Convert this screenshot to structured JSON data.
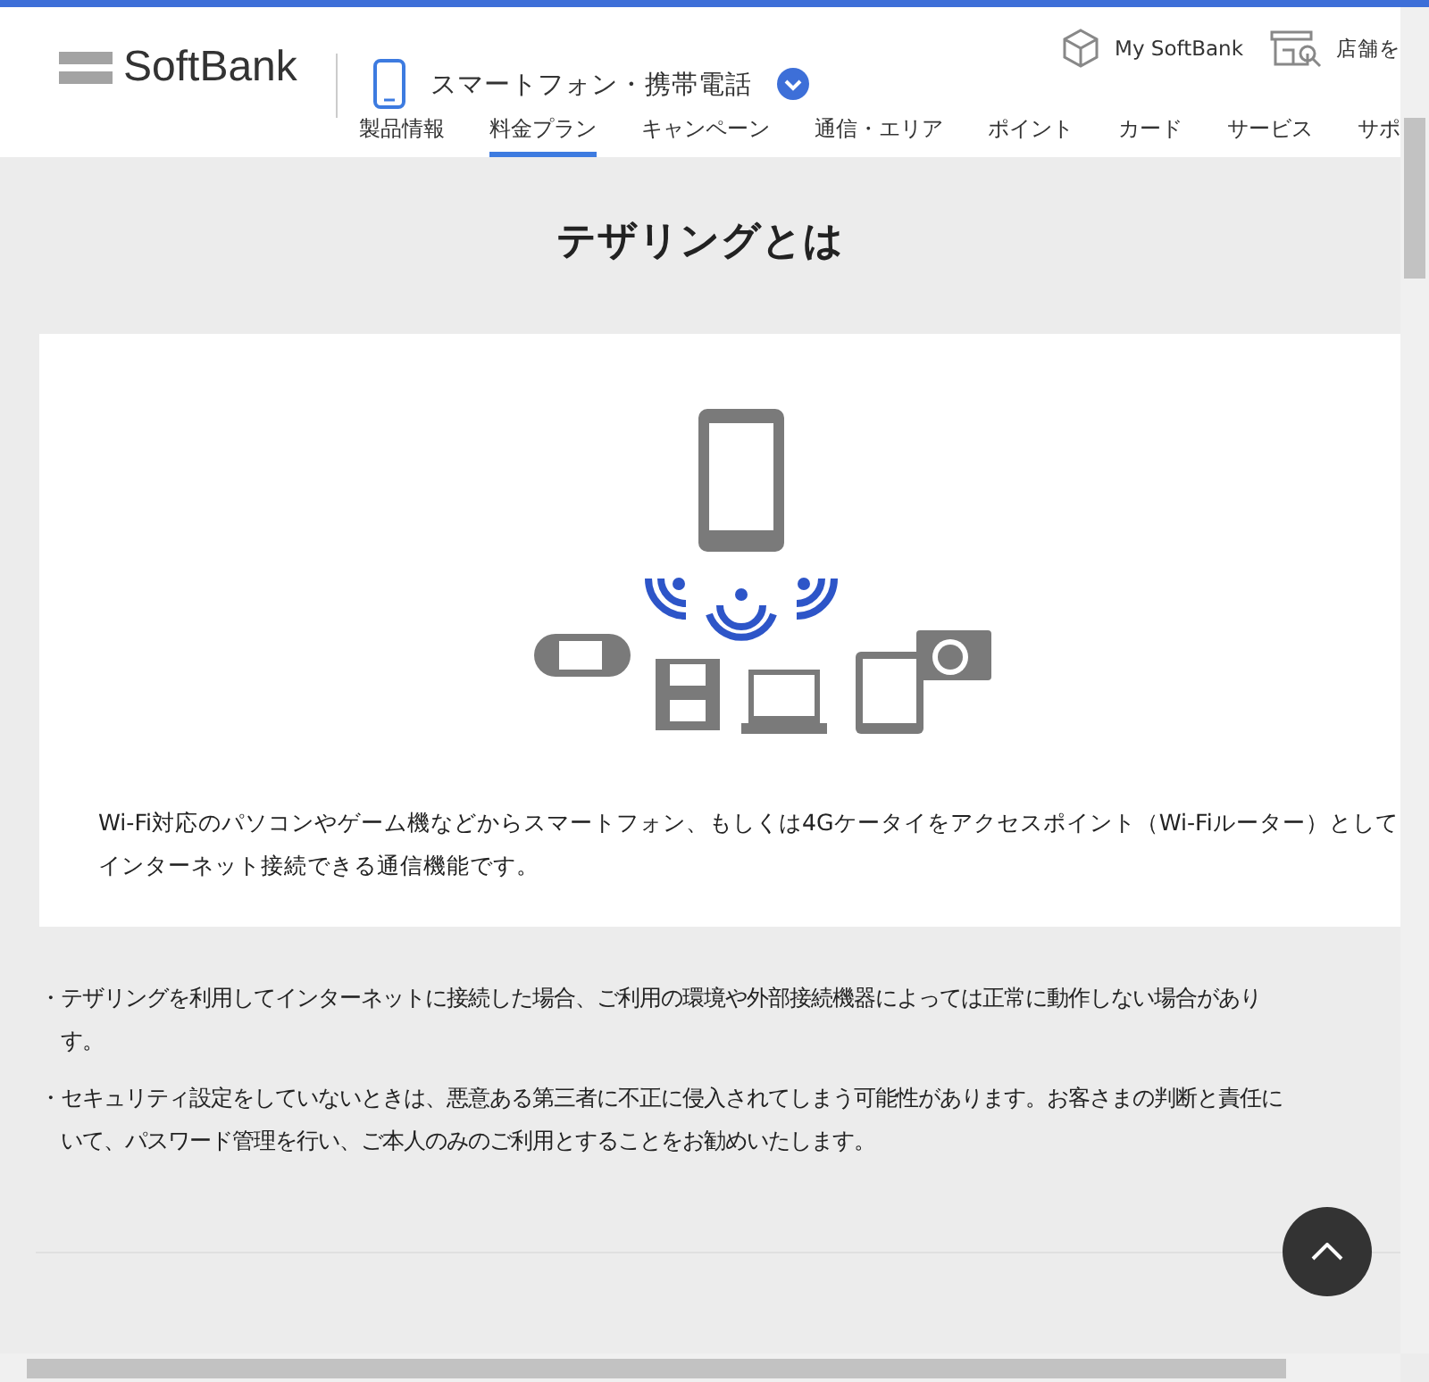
{
  "header": {
    "logo": "SoftBank",
    "category": "スマートフォン・携帯電話",
    "utility_links": [
      {
        "label": "My SoftBank",
        "kind": "account"
      },
      {
        "label": "店舗を",
        "kind": "store"
      }
    ],
    "nav": [
      {
        "label": "製品情報",
        "selected": false
      },
      {
        "label": "料金プラン",
        "selected": true
      },
      {
        "label": "キャンペーン",
        "selected": false
      },
      {
        "label": "通信・エリア",
        "selected": false
      },
      {
        "label": "ポイント",
        "selected": false
      },
      {
        "label": "カード",
        "selected": false
      },
      {
        "label": "サービス",
        "selected": false
      },
      {
        "label": "サポ",
        "selected": false
      }
    ]
  },
  "title": "テザリングとは",
  "card": {
    "description_lines": [
      "Wi-Fi対応のパソコンやゲーム機などからスマートフォン、もしくは4Gケータイをアクセスポイント（Wi-Fiルーター）として",
      "インターネット接続できる通信機能です。"
    ]
  },
  "notes": [
    {
      "bullet": "・",
      "lines": [
        "テザリングを利用してインターネットに接続した場合、ご利用の環境や外部接続機器によっては正常に動作しない場合があり",
        "す。"
      ]
    },
    {
      "bullet": "・",
      "lines": [
        "セキュリティ設定をしていないときは、悪意ある第三者に不正に侵入されてしまう可能性があります。お客さまの判断と責任に",
        "いて、パスワード管理を行い、ご本人のみのご利用とすることをお勧めいたします。"
      ]
    }
  ]
}
